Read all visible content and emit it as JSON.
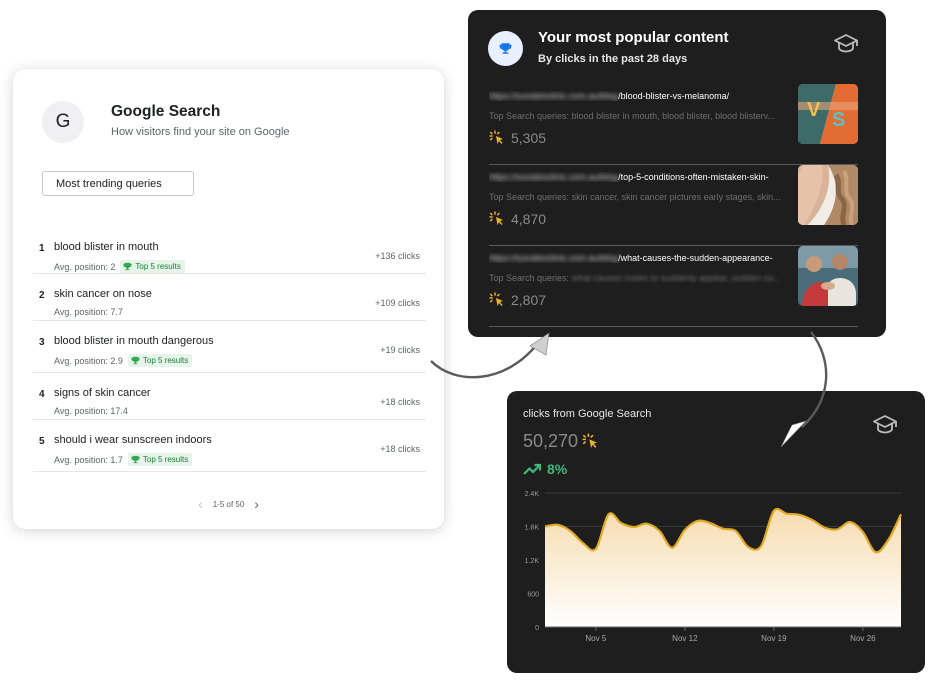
{
  "google_search": {
    "avatar_letter": "G",
    "title": "Google Search",
    "subtitle": "How visitors find your site on Google",
    "dropdown_label": "Most trending queries",
    "rows": [
      {
        "num": "1",
        "query": "blood blister in mouth",
        "position": "Avg. position: 2",
        "badge": "Top 5 results",
        "clicks": "+136 clicks"
      },
      {
        "num": "2",
        "query": "skin cancer on nose",
        "position": "Avg. position: 7.7",
        "badge": "",
        "clicks": "+109 clicks"
      },
      {
        "num": "3",
        "query": "blood blister in mouth dangerous",
        "position": "Avg. position: 2.9",
        "badge": "Top 5 results",
        "clicks": "+19 clicks"
      },
      {
        "num": "4",
        "query": "signs of skin cancer",
        "position": "Avg. position: 17.4",
        "badge": "",
        "clicks": "+18 clicks"
      },
      {
        "num": "5",
        "query": "should i wear sunscreen indoors",
        "position": "Avg. position: 1.7",
        "badge": "Top 5 results",
        "clicks": "+18 clicks"
      }
    ],
    "pagination": "1-5 of 50",
    "badge_color": "#188038"
  },
  "popular_content": {
    "title": "Your most popular content",
    "subtitle": "By clicks in the past 28 days",
    "items": [
      {
        "url_prefix": "https://sunskinclinic.com.au/blog",
        "url_path": "/blood-blister-vs-melanoma/",
        "queries_label": "Top Search queries:",
        "queries": "blood blister in mouth, blood blister, blood blisterv...",
        "clicks": "5,305",
        "thumb": "vs-graphic"
      },
      {
        "url_prefix": "https://sunskinclinic.com.au/blog",
        "url_path": "/top-5-conditions-often-mistaken-skin-",
        "queries_label": "Top Search queries:",
        "queries": "skin cancer, skin cancer pictures early stages, skin...",
        "clicks": "4,870",
        "thumb": "neck-photo"
      },
      {
        "url_prefix": "https://sunskinclinic.com.au/blog",
        "url_path": "/what-causes-the-sudden-appearance-",
        "queries_label": "Top Search queries:",
        "queries": "what causes moles to suddenly appear, sudden ou...",
        "clicks": "2,807",
        "thumb": "people-photo"
      }
    ]
  },
  "clicks_chart": {
    "title": "clicks from Google Search",
    "total": "50,270",
    "trend": "8%",
    "accent_color": "#e3a823",
    "trend_color": "#3dbb7a"
  },
  "chart_data": {
    "type": "area",
    "title": "clicks from Google Search",
    "xlabel": "",
    "ylabel": "",
    "ylim": [
      0,
      2400
    ],
    "yticks": [
      "0",
      "600",
      "1.2K",
      "1.8K",
      "2.4K"
    ],
    "ytick_values": [
      0,
      600,
      1200,
      1800,
      2400
    ],
    "xticks": [
      "Nov 5",
      "Nov 12",
      "Nov 19",
      "Nov 26"
    ],
    "xtick_positions": [
      4,
      11,
      18,
      25
    ],
    "x": [
      0,
      1,
      2,
      3,
      4,
      5,
      6,
      7,
      8,
      9,
      10,
      11,
      12,
      13,
      14,
      15,
      16,
      17,
      18,
      19,
      20,
      21,
      22,
      23,
      24,
      25,
      26,
      27,
      28
    ],
    "values": [
      1800,
      1830,
      1720,
      1500,
      1400,
      2020,
      1860,
      1790,
      1850,
      1720,
      1420,
      1740,
      1900,
      1860,
      1760,
      1720,
      1430,
      1450,
      2080,
      2030,
      2010,
      1920,
      1780,
      1750,
      1880,
      1700,
      1340,
      1560,
      2020
    ],
    "grid": true,
    "legend": "none"
  }
}
